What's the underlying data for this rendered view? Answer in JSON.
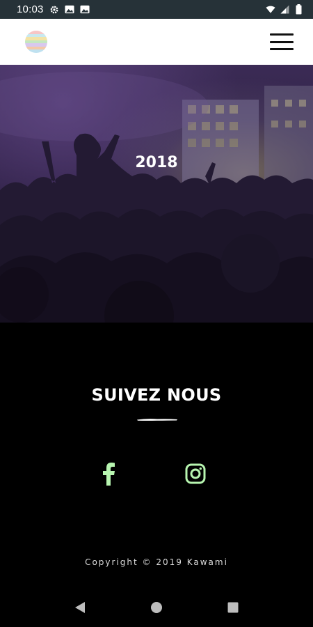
{
  "status_bar": {
    "time": "10:03",
    "icons": [
      "settings-icon",
      "image-icon",
      "image-icon",
      "wifi-icon",
      "signal-icon",
      "battery-icon"
    ]
  },
  "header": {
    "logo": "striped-circle-logo",
    "menu_icon": "hamburger-icon"
  },
  "hero": {
    "year": "2018"
  },
  "follow": {
    "title": "SUIVEZ NOUS",
    "social": [
      "facebook-icon",
      "instagram-icon"
    ],
    "icon_color": "#b7f5b0"
  },
  "footer": {
    "copyright": "Copyright © 2019 Kawami"
  },
  "nav_bar": {
    "buttons": [
      "back-icon",
      "home-icon",
      "recents-icon"
    ]
  },
  "colors": {
    "status_bar_bg": "#263238",
    "header_bg": "#ffffff",
    "page_bg": "#000000",
    "hero_tint": "#3b2b55",
    "accent_green": "#b7f5b0"
  }
}
